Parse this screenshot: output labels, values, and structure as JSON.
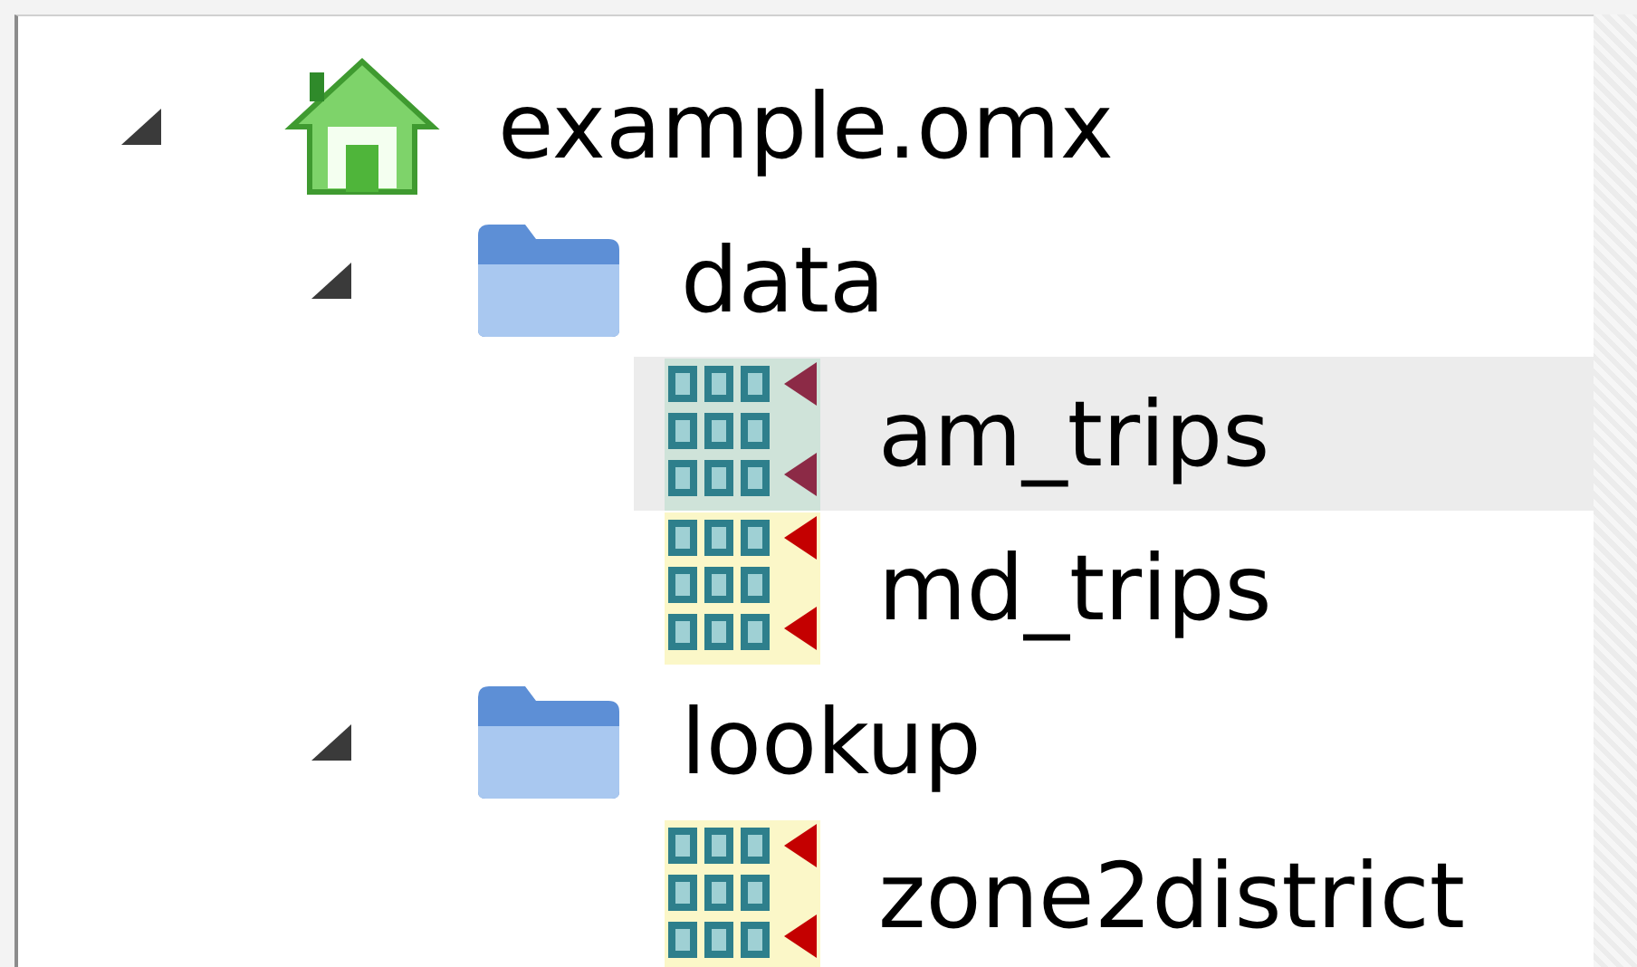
{
  "tree": [
    {
      "kind": "file",
      "label": "example.omx",
      "expanded": true,
      "selected": false,
      "children": [
        {
          "kind": "group",
          "label": "data",
          "expanded": true,
          "selected": false,
          "children": [
            {
              "kind": "matrix",
              "label": "am_trips",
              "selected": true
            },
            {
              "kind": "matrix",
              "label": "md_trips",
              "selected": false
            }
          ]
        },
        {
          "kind": "group",
          "label": "lookup",
          "expanded": true,
          "selected": false,
          "children": [
            {
              "kind": "matrix",
              "label": "zone2district",
              "selected": false
            }
          ]
        }
      ]
    }
  ]
}
